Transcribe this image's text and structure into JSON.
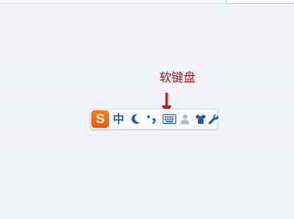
{
  "annotation": {
    "label": "软键盘"
  },
  "toolbar": {
    "logo_letter": "S",
    "input_mode": "中"
  },
  "icons": {
    "moon": "moon-icon",
    "punctuation": "punctuation-icon",
    "soft_keyboard": "keyboard-icon",
    "user": "user-icon",
    "skin": "shirt-icon",
    "tools": "wrench-icon"
  },
  "colors": {
    "annotation": "#b01818",
    "logo_bg": "#f05a00",
    "toolbar_icon": "#1f5fa8"
  }
}
